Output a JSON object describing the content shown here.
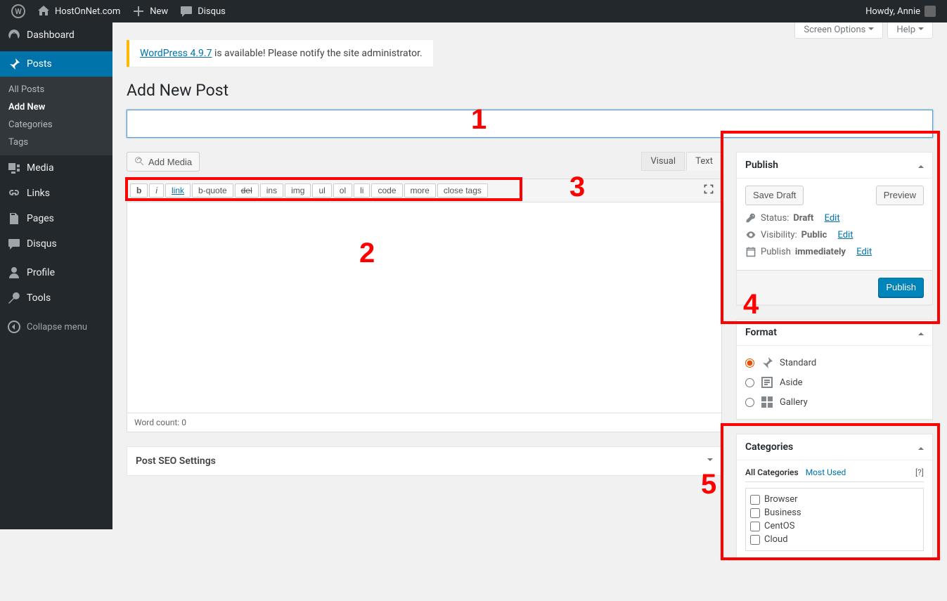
{
  "adminbar": {
    "site_name": "HostOnNet.com",
    "new_label": "New",
    "comments_label": "Disqus",
    "greeting": "Howdy, Annie"
  },
  "menu": {
    "dashboard": "Dashboard",
    "posts": "Posts",
    "posts_sub": {
      "all": "All Posts",
      "add": "Add New",
      "cats": "Categories",
      "tags": "Tags"
    },
    "media": "Media",
    "links": "Links",
    "pages": "Pages",
    "disqus": "Disqus",
    "profile": "Profile",
    "tools": "Tools",
    "collapse": "Collapse menu"
  },
  "screen_meta": {
    "options": "Screen Options",
    "help": "Help"
  },
  "update_nag": {
    "link": "WordPress 4.9.7",
    "text": " is available! Please notify the site administrator."
  },
  "page_title": "Add New Post",
  "title_placeholder": "",
  "media_button": "Add Media",
  "editor_tabs": {
    "visual": "Visual",
    "text": "Text"
  },
  "quicktags": [
    "b",
    "i",
    "link",
    "b-quote",
    "del",
    "ins",
    "img",
    "ul",
    "ol",
    "li",
    "code",
    "more",
    "close tags"
  ],
  "word_count_label": "Word count: ",
  "word_count_value": "0",
  "seo_title": "Post SEO Settings",
  "publish": {
    "title": "Publish",
    "save_draft": "Save Draft",
    "preview": "Preview",
    "status_label": "Status: ",
    "status_value": "Draft",
    "status_edit": "Edit",
    "visibility_label": "Visibility: ",
    "visibility_value": "Public",
    "visibility_edit": "Edit",
    "publish_label": "Publish ",
    "publish_value": "immediately",
    "publish_edit": "Edit",
    "publish_button": "Publish"
  },
  "format": {
    "title": "Format",
    "options": [
      "Standard",
      "Aside",
      "Gallery"
    ],
    "selected": "Standard"
  },
  "categories": {
    "title": "Categories",
    "tab_all": "All Categories",
    "tab_most": "Most Used",
    "help": "[?]",
    "items": [
      "Browser",
      "Business",
      "CentOS",
      "Cloud"
    ]
  },
  "annotations": {
    "1": "1",
    "2": "2",
    "3": "3",
    "4": "4",
    "5": "5"
  }
}
